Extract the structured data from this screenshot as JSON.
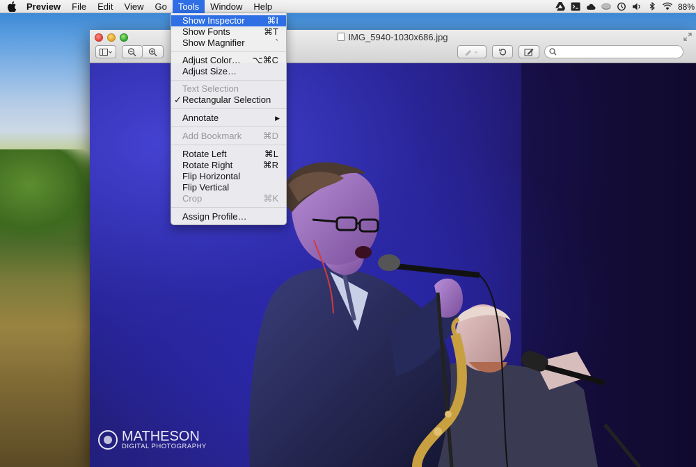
{
  "menubar": {
    "app_name": "Preview",
    "items": [
      "File",
      "Edit",
      "View",
      "Go",
      "Tools",
      "Window",
      "Help"
    ],
    "active_item": "Tools",
    "battery": "88%"
  },
  "window": {
    "title": "IMG_5940-1030x686.jpg",
    "search_placeholder": ""
  },
  "tools_menu": {
    "items": [
      {
        "label": "Show Inspector",
        "shortcut": "⌘I",
        "state": "highlighted"
      },
      {
        "label": "Show Fonts",
        "shortcut": "⌘T",
        "state": "enabled"
      },
      {
        "label": "Show Magnifier",
        "shortcut": "`",
        "state": "enabled"
      },
      {
        "label": "Adjust Color…",
        "shortcut": "⌥⌘C",
        "state": "enabled"
      },
      {
        "label": "Adjust Size…",
        "shortcut": "",
        "state": "enabled"
      },
      {
        "label": "Text Selection",
        "shortcut": "",
        "state": "disabled"
      },
      {
        "label": "Rectangular Selection",
        "shortcut": "",
        "state": "checked"
      },
      {
        "label": "Annotate",
        "shortcut": "▶",
        "state": "submenu"
      },
      {
        "label": "Add Bookmark",
        "shortcut": "⌘D",
        "state": "disabled"
      },
      {
        "label": "Rotate Left",
        "shortcut": "⌘L",
        "state": "enabled"
      },
      {
        "label": "Rotate Right",
        "shortcut": "⌘R",
        "state": "enabled"
      },
      {
        "label": "Flip Horizontal",
        "shortcut": "",
        "state": "enabled"
      },
      {
        "label": "Flip Vertical",
        "shortcut": "",
        "state": "enabled"
      },
      {
        "label": "Crop",
        "shortcut": "⌘K",
        "state": "disabled"
      },
      {
        "label": "Assign Profile…",
        "shortcut": "",
        "state": "enabled"
      }
    ],
    "check_mark": "✓"
  },
  "watermark": {
    "name": "MATHESON",
    "subtitle": "DIGITAL PHOTOGRAPHY"
  },
  "colors": {
    "menu_highlight": "#2f6fe6",
    "stage_blue": "#2a2596"
  }
}
